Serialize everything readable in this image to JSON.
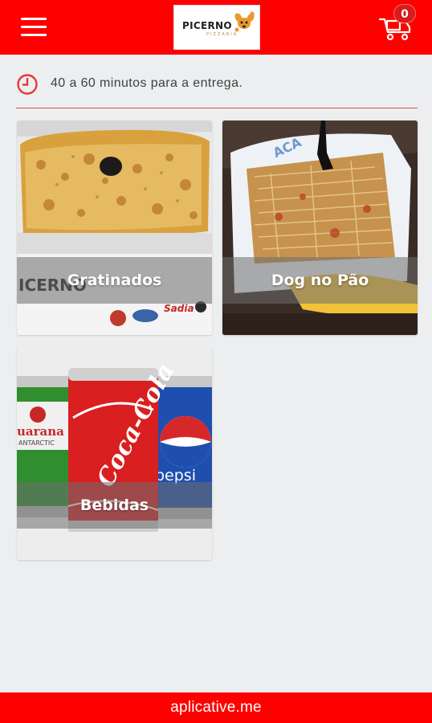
{
  "header": {
    "logo_text": "PICERNO",
    "logo_subtext": "PIZZARIA",
    "cart_count": "0"
  },
  "delivery": {
    "text": "40 a 60 minutos para a entrega."
  },
  "categories": [
    {
      "label": "Gratinados"
    },
    {
      "label": "Dog no Pão"
    },
    {
      "label": "Bebidas"
    }
  ],
  "footer": {
    "text": "aplicative.me"
  },
  "colors": {
    "brand_red": "#fe0000",
    "background": "#eceef0",
    "divider": "#d9534f"
  },
  "icons": [
    "menu-icon",
    "logo-dog-icon",
    "delivery-cart-icon",
    "clock-icon"
  ]
}
